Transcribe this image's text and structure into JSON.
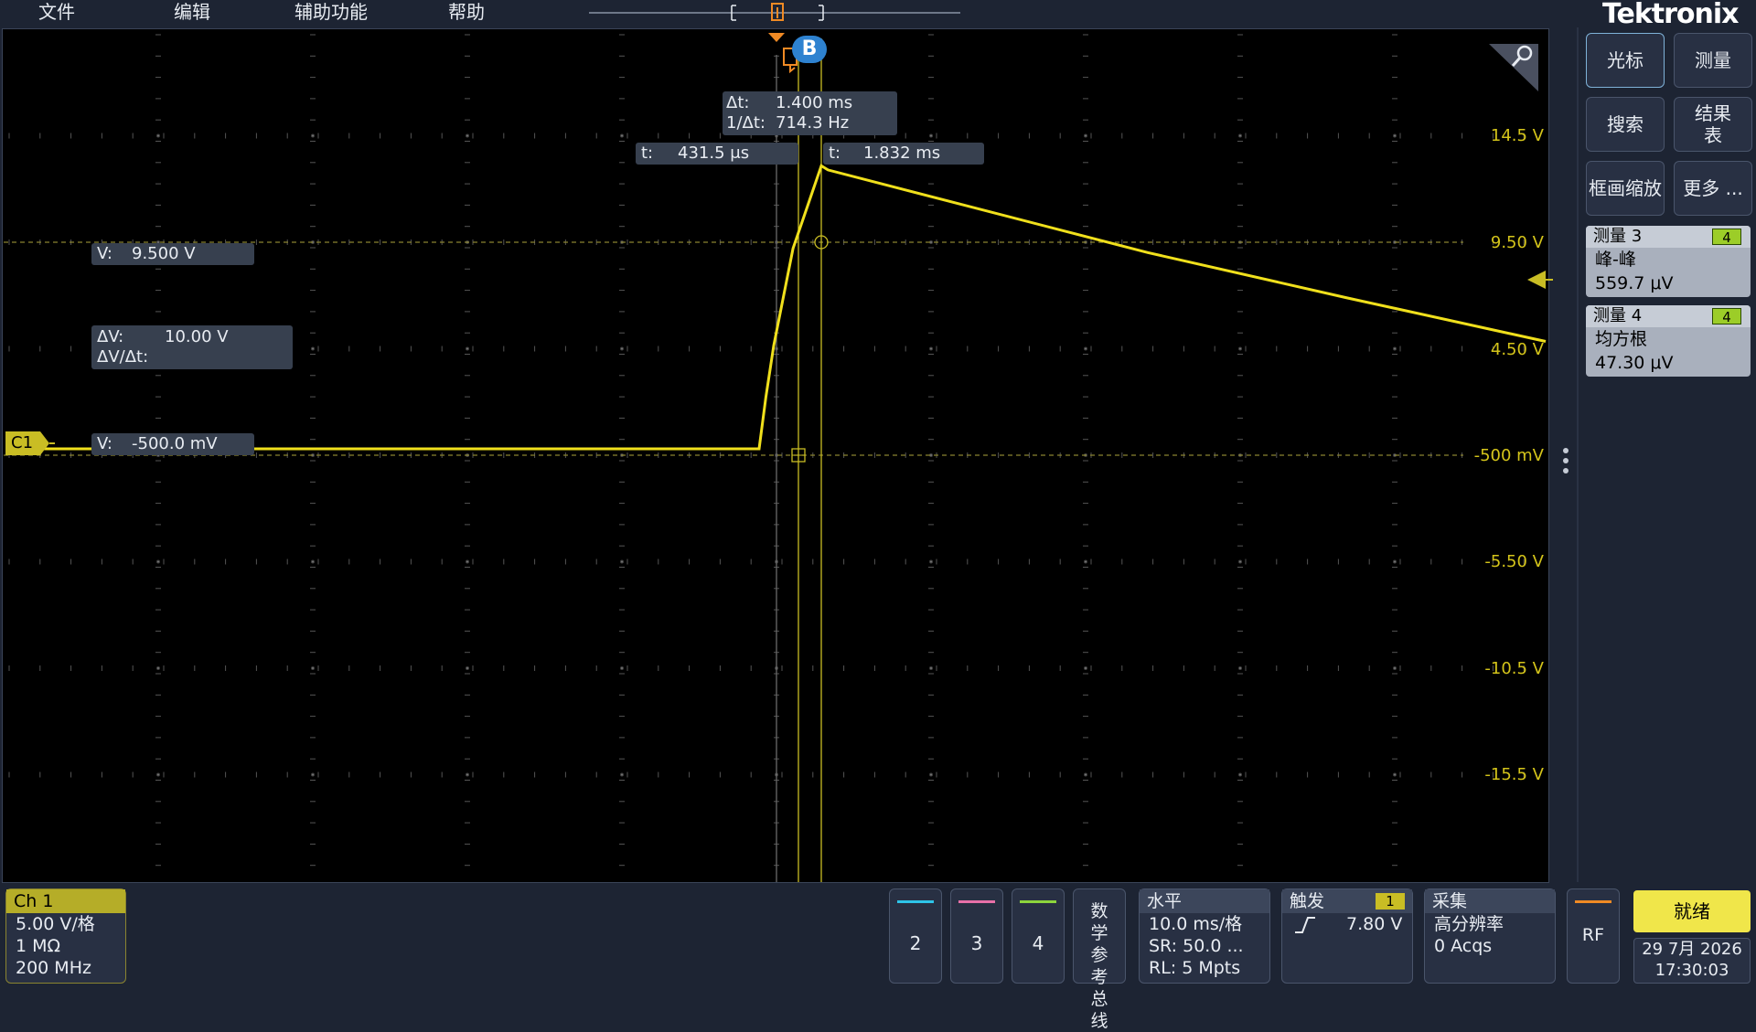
{
  "menu": {
    "items": [
      "文件",
      "编辑",
      "辅助功能",
      "帮助"
    ]
  },
  "brand": "Tektronix",
  "colors": {
    "ch1": "#f0e01c",
    "ch2": "#2ec4e8",
    "ch3": "#e870a8",
    "ch4": "#8cd43c",
    "background": "#1d2433",
    "accent": "#7fb2d8"
  },
  "readouts": {
    "delta_t_label": "Δt:",
    "delta_t_value": "1.400 ms",
    "inv_delta_t_label": "1/Δt:",
    "inv_delta_t_value": "714.3 Hz",
    "cursor_a_t_label": "t:",
    "cursor_a_t_value": "431.5 μs",
    "cursor_b_t_label": "t:",
    "cursor_b_t_value": "1.832 ms",
    "cursor_b_v_label": "V:",
    "cursor_b_v_value": "9.500 V",
    "delta_v_label": "ΔV:",
    "delta_v_value": "10.00 V",
    "delta_v_dt_label": "ΔV/Δt:",
    "cursor_a_v_label": "V:",
    "cursor_a_v_value": "-500.0 mV"
  },
  "trigger_marker": "B",
  "channel_marker": "C1",
  "scale_labels": [
    "14.5 V",
    "9.50 V",
    "4.50 V",
    "-500 mV",
    "-5.50 V",
    "-10.5 V",
    "-15.5 V"
  ],
  "side_buttons": {
    "cursors": "光标",
    "measure": "测量",
    "search": "搜索",
    "results": "结果表",
    "zoom": "框画缩放",
    "more": "更多 ..."
  },
  "measurements": [
    {
      "title": "测量 3",
      "badge": "4",
      "type": "峰-峰",
      "value": "559.7 μV"
    },
    {
      "title": "测量 4",
      "badge": "4",
      "type": "均方根",
      "value": "47.30 μV"
    }
  ],
  "ch1_box": {
    "title": "Ch 1",
    "scale": "5.00 V/格",
    "impedance": "1 MΩ",
    "bandwidth": "200 MHz"
  },
  "channel_buttons": [
    "2",
    "3",
    "4"
  ],
  "math_ref_bus": "数学参考总线",
  "horizontal": {
    "title": "水平",
    "scale": "10.0 ms/格",
    "sr": "SR: 50.0 ...",
    "rl": "RL: 5 Mpts"
  },
  "trigger": {
    "title": "触发",
    "badge": "1",
    "level": "7.80 V"
  },
  "acquisition": {
    "title": "采集",
    "mode": "高分辨率",
    "acqs": "0 Acqs"
  },
  "rf_label": "RF",
  "run_status": "就绪",
  "date": "29 7月 2026",
  "time": "17:30:03",
  "trace": {
    "unit_y": "V",
    "unit_x": "ms",
    "points": [
      [
        -0.1,
        -0.5
      ],
      [
        0.0,
        -0.5
      ],
      [
        0.2,
        2.0
      ],
      [
        0.432,
        4.5
      ],
      [
        1.0,
        9.2
      ],
      [
        1.832,
        13.2
      ],
      [
        2.0,
        13.0
      ],
      [
        5.0,
        11.5
      ],
      [
        10.0,
        9.0
      ],
      [
        15.0,
        6.8
      ],
      [
        20.0,
        4.7
      ]
    ]
  }
}
